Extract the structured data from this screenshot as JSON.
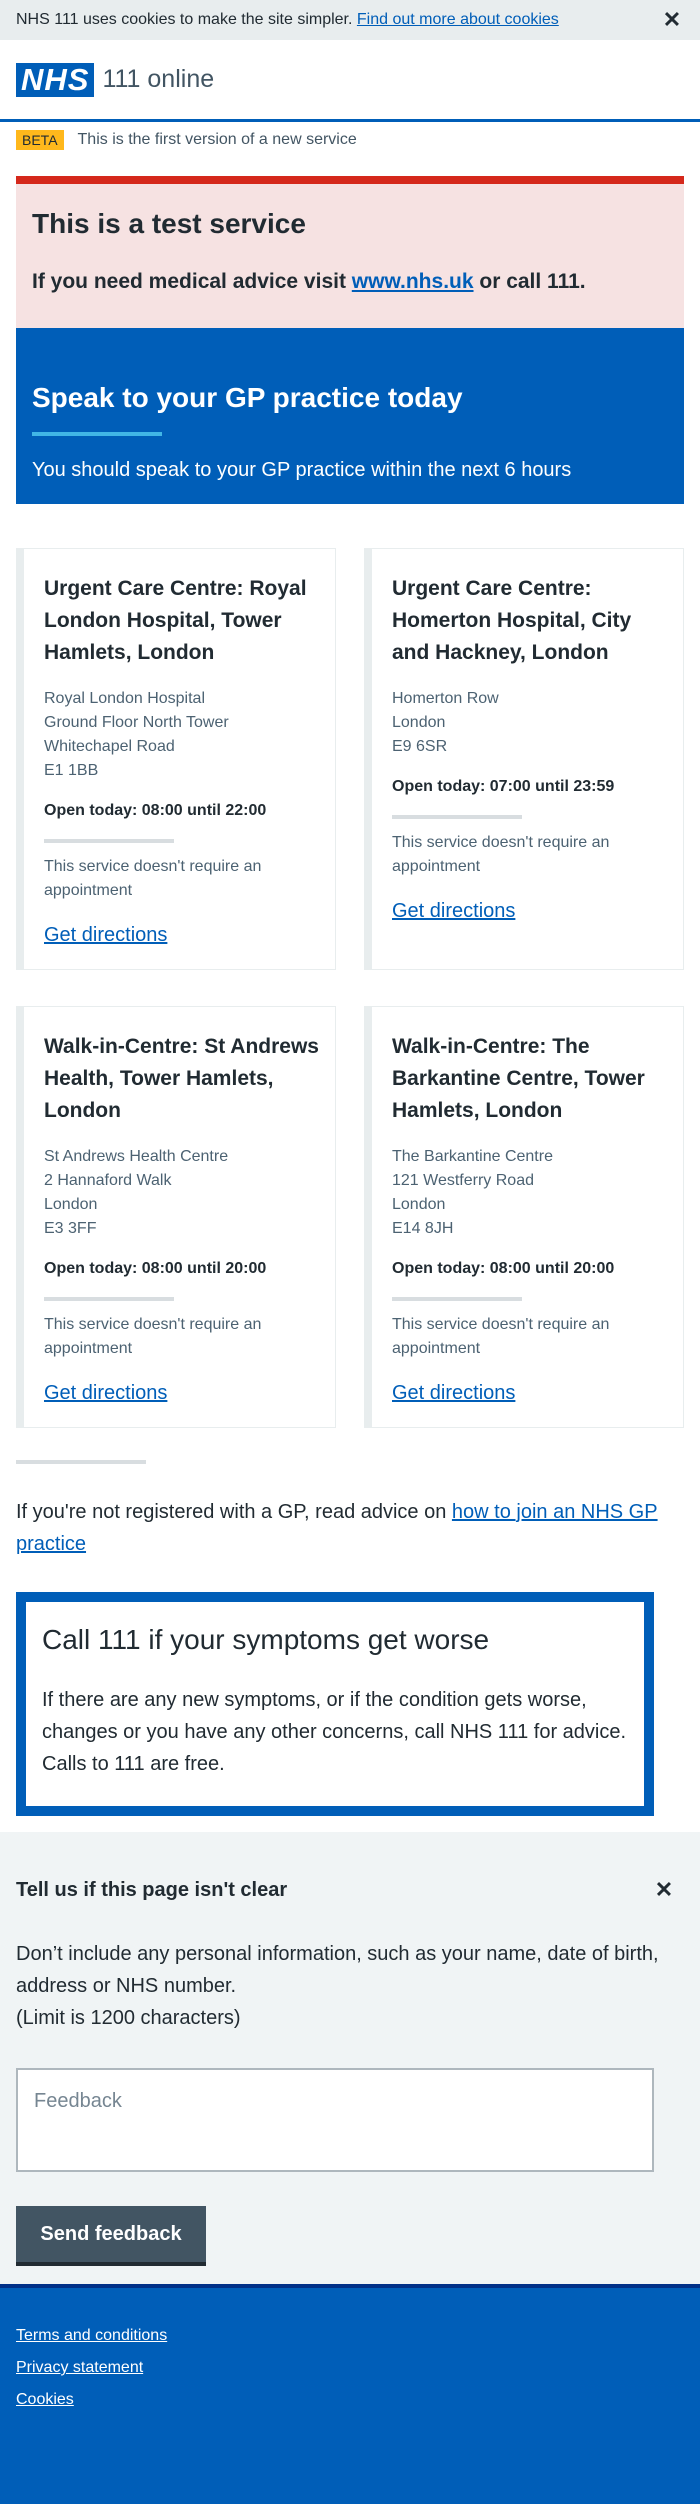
{
  "cookie_banner": {
    "text": "NHS 111 uses cookies to make the site simpler.",
    "link": "Find out more about cookies",
    "close": "✕"
  },
  "header": {
    "logo": "NHS",
    "service_name": "111 online"
  },
  "beta": {
    "tag": "BETA",
    "text": "This is the first version of a new service"
  },
  "test_banner": {
    "title": "This is a test service",
    "text_before": "If you need medical advice visit ",
    "link": "www.nhs.uk",
    "text_after": " or call 111."
  },
  "care_advice": {
    "title": "Speak to your GP practice today",
    "subtitle": "You should speak to your GP practice within the next 6 hours"
  },
  "services": [
    {
      "title": "Urgent Care Centre: Royal London Hospital, Tower Hamlets, London",
      "address": [
        "Royal London Hospital",
        "Ground Floor North Tower",
        "Whitechapel Road",
        "E1 1BB"
      ],
      "hours": "Open today: 08:00 until 22:00",
      "note": "This service doesn't require an appointment",
      "link": "Get directions"
    },
    {
      "title": "Urgent Care Centre: Homerton Hospital, City and Hackney, London",
      "address": [
        "Homerton Row",
        "London",
        "E9 6SR"
      ],
      "hours": "Open today: 07:00 until 23:59",
      "note": "This service doesn't require an appointment",
      "link": "Get directions"
    },
    {
      "title": "Walk-in-Centre: St Andrews Health, Tower Hamlets, London",
      "address": [
        "St Andrews Health Centre",
        "2 Hannaford Walk",
        "London",
        "E3 3FF"
      ],
      "hours": "Open today: 08:00 until 20:00",
      "note": "This service doesn't require an appointment",
      "link": "Get directions"
    },
    {
      "title": "Walk-in-Centre: The Barkantine Centre, Tower Hamlets, London",
      "address": [
        "The Barkantine Centre",
        "121 Westferry Road",
        "London",
        "E14 8JH"
      ],
      "hours": "Open today: 08:00 until 20:00",
      "note": "This service doesn't require an appointment",
      "link": "Get directions"
    }
  ],
  "gp_advice": {
    "text": "If you're not registered with a GP, read advice on ",
    "link": "how to join an NHS GP practice"
  },
  "callout": {
    "title": "Call 111 if your symptoms get worse",
    "text": "If there are any new symptoms, or if the condition gets worse, changes or you have any other concerns, call NHS 111 for advice. Calls to 111 are free."
  },
  "feedback": {
    "title": "Tell us if this page isn't clear",
    "close": "✕",
    "text": "Don’t include any personal information, such as your name, date of birth, address or NHS number.",
    "limit": "(Limit is 1200 characters)",
    "placeholder": "Feedback",
    "button": "Send feedback"
  },
  "footer": {
    "links": [
      "Terms and conditions",
      "Privacy statement",
      "Cookies"
    ]
  },
  "colors": {
    "nhs_blue": "#005eb8",
    "beta_yellow": "#ffb81c",
    "test_red": "#d5281b",
    "test_bg": "#f6e2e2",
    "feedback_bg": "#f0f4f5",
    "button_grey": "#425563"
  }
}
